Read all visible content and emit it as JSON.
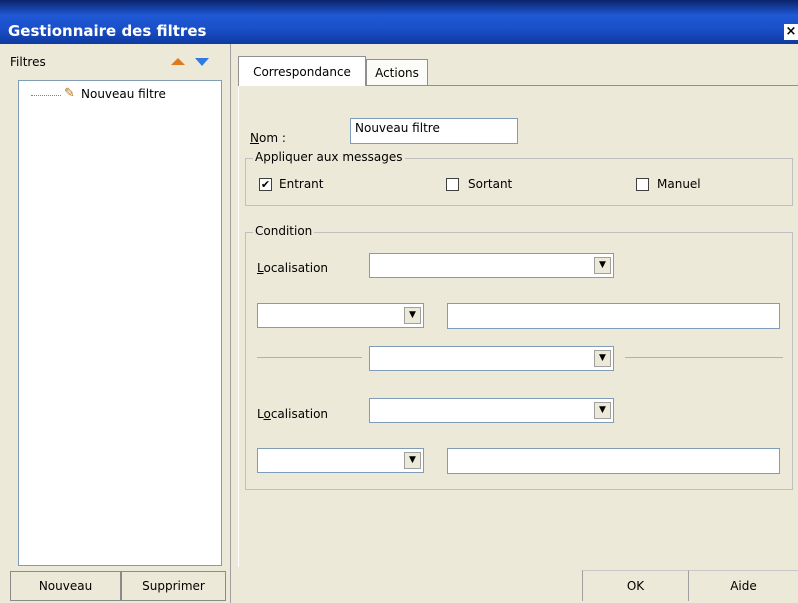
{
  "window": {
    "title": "Gestionnaire des filtres",
    "close_glyph": "×"
  },
  "filters_pane": {
    "label": "Filtres",
    "items": [
      {
        "label": "Nouveau filtre",
        "icon": "broom-icon"
      }
    ],
    "new_button": "Nouveau",
    "delete_button": "Supprimer"
  },
  "tabs": [
    {
      "label": "Correspondance",
      "active": true
    },
    {
      "label": "Actions",
      "active": false
    }
  ],
  "form": {
    "name_label_prefix": "N",
    "name_label_rest": "om :",
    "name_value": "Nouveau filtre",
    "apply_group_title": "Appliquer aux messages",
    "incoming_label": "Entrant",
    "incoming_checked": "✔",
    "outgoing_label": "Sortant",
    "manual_label": "Manuel",
    "condition_title": "Condition",
    "location1_prefix": "L",
    "location1_rest": "ocalisation",
    "location2_prefix": "L",
    "location2_mid": "o",
    "location2_rest": "calisation",
    "dropdown_arrow": "▼"
  },
  "buttons": {
    "ok": "OK",
    "help": "Aide"
  }
}
